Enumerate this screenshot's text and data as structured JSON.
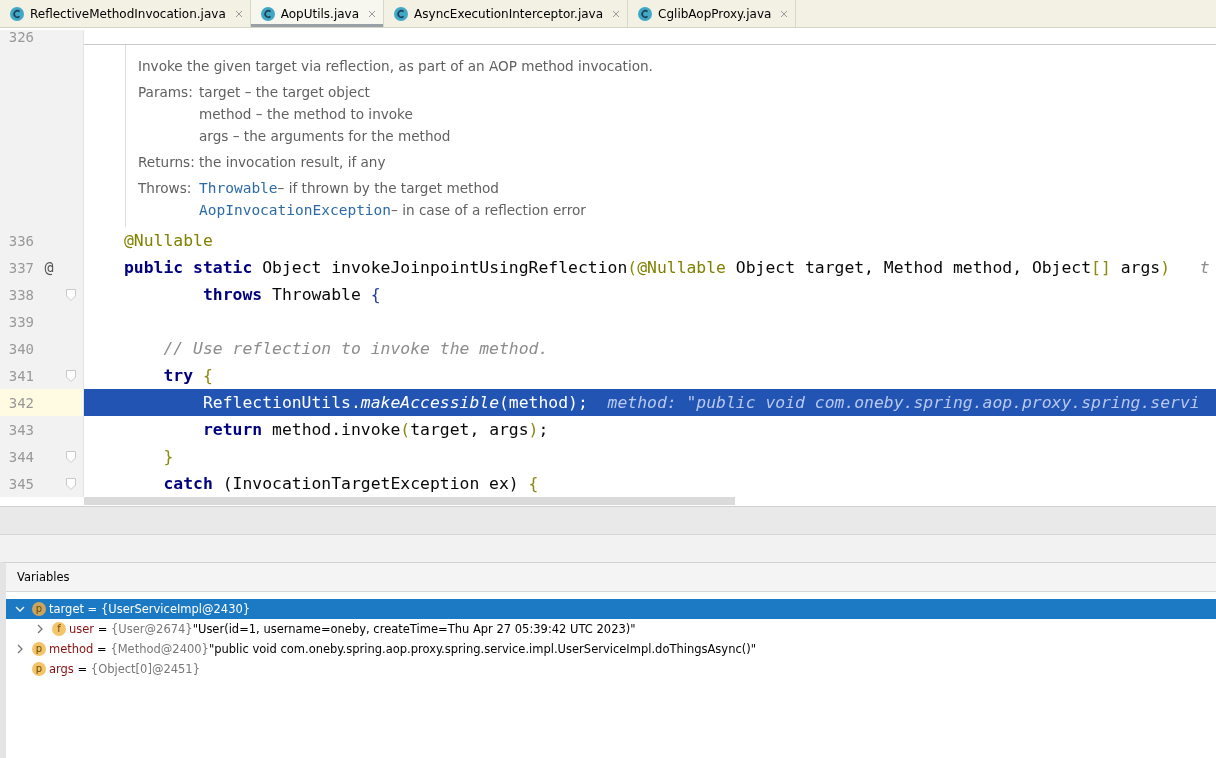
{
  "tabs": [
    {
      "label": "ReflectiveMethodInvocation.java",
      "selected": false
    },
    {
      "label": "AopUtils.java",
      "selected": true
    },
    {
      "label": "AsyncExecutionInterceptor.java",
      "selected": false
    },
    {
      "label": "CglibAopProxy.java",
      "selected": false
    }
  ],
  "editor": {
    "top_line": "326",
    "doc": {
      "summary": "Invoke the given target via reflection, as part of an AOP method invocation.",
      "params_label": "Params:",
      "params": [
        "target – the target object",
        "method – the method to invoke",
        "args – the arguments for the method"
      ],
      "returns_label": "Returns:",
      "returns": "the invocation result, if any",
      "throws_label": "Throws:",
      "throws": [
        {
          "link": "Throwable",
          "text": "– if thrown by the target method"
        },
        {
          "link": "AopInvocationException",
          "text": "– in case of a reflection error"
        }
      ]
    },
    "lines": [
      {
        "number": "336",
        "fold": false,
        "selected": false,
        "tokens": [
          {
            "text": "@Nullable",
            "kind": "annotation"
          }
        ]
      },
      {
        "number": "337",
        "marker": "@",
        "fold": false,
        "selected": false,
        "tokens": [
          {
            "text": "public static",
            "kind": "keyword"
          },
          {
            "text": " Object invokeJoinpointUsingReflection",
            "kind": "plain"
          },
          {
            "text": "(",
            "kind": "bracket"
          },
          {
            "text": "@Nullable",
            "kind": "annotation"
          },
          {
            "text": " Object target, Method method, Object",
            "kind": "plain"
          },
          {
            "text": "[]",
            "kind": "bracket"
          },
          {
            "text": " args",
            "kind": "plain"
          },
          {
            "text": ")",
            "kind": "bracket"
          },
          {
            "text": "   t",
            "kind": "hint"
          }
        ]
      },
      {
        "number": "338",
        "fold": true,
        "selected": false,
        "tokens": [
          {
            "text": "        throws",
            "kind": "keyword"
          },
          {
            "text": " Throwable ",
            "kind": "plain"
          },
          {
            "text": "{",
            "kind": "brace"
          }
        ]
      },
      {
        "number": "339",
        "fold": false,
        "selected": false
      },
      {
        "number": "340",
        "fold": false,
        "selected": false,
        "tokens": [
          {
            "text": "    // Use reflection to invoke the method.",
            "kind": "comment"
          }
        ]
      },
      {
        "number": "341",
        "fold": true,
        "selected": false,
        "tokens": [
          {
            "text": "    try",
            "kind": "keyword"
          },
          {
            "text": " {",
            "kind": "bracket"
          }
        ]
      },
      {
        "number": "342",
        "fold": false,
        "selected": true,
        "tokens": [
          {
            "text": "        ReflectionUtils.",
            "kind": "plain"
          },
          {
            "text": "makeAccessible",
            "kind": "italic"
          },
          {
            "text": "(method);",
            "kind": "plain"
          },
          {
            "text": "  method: \"public void com.oneby.spring.aop.proxy.spring.servi",
            "kind": "hint"
          }
        ]
      },
      {
        "number": "343",
        "fold": false,
        "selected": false,
        "tokens": [
          {
            "text": "        return",
            "kind": "keyword"
          },
          {
            "text": " method.invoke",
            "kind": "plain"
          },
          {
            "text": "(",
            "kind": "bracket"
          },
          {
            "text": "target, args",
            "kind": "plain"
          },
          {
            "text": ")",
            "kind": "bracket"
          },
          {
            "text": ";",
            "kind": "plain"
          }
        ]
      },
      {
        "number": "344",
        "fold": true,
        "selected": false,
        "tokens": [
          {
            "text": "    }",
            "kind": "bracket"
          }
        ]
      },
      {
        "number": "345",
        "fold": true,
        "selected": false,
        "tokens": [
          {
            "text": "    catch",
            "kind": "keyword"
          },
          {
            "text": " (InvocationTargetException ex) ",
            "kind": "plain"
          },
          {
            "text": "{",
            "kind": "bracket"
          }
        ]
      }
    ]
  },
  "variables": {
    "title": "Variables",
    "rows": [
      {
        "badge": "p",
        "name": "target",
        "eq": " = ",
        "value": "{UserServiceImpl@2430}",
        "selected": true,
        "expanded": true,
        "children": [
          {
            "badge": "f",
            "name": "user",
            "eq": " = ",
            "value": "{User@2674}",
            "detail": "\"User(id=1, username=oneby, createTime=Thu Apr 27 05:39:42 UTC 2023)\"",
            "selected": false,
            "expanded": false
          }
        ]
      },
      {
        "badge": "p",
        "name": "method",
        "eq": " = ",
        "value": "{Method@2400}",
        "detail": "\"public void com.oneby.spring.aop.proxy.spring.service.impl.UserServiceImpl.doThingsAsync()\"",
        "selected": false,
        "expanded": false
      },
      {
        "badge": "p",
        "name": "args",
        "eq": " = ",
        "value": "{Object[0]@2451}",
        "selected": false
      }
    ]
  }
}
